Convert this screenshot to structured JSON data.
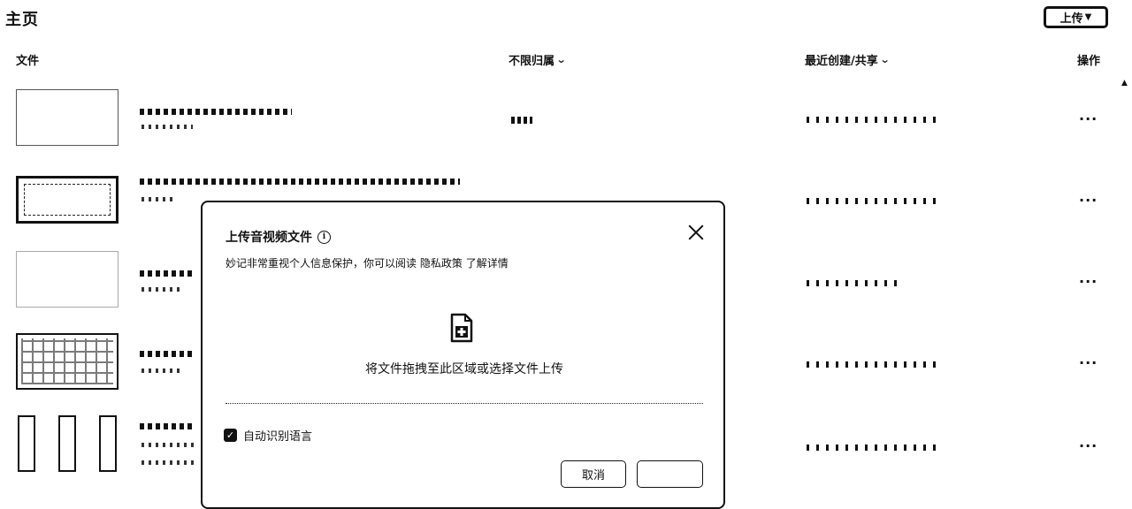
{
  "header": {
    "title": "主页",
    "upload_label": "上传",
    "upload_caret": "▼"
  },
  "columns": {
    "file": "文件",
    "owner": "不限归属",
    "created": "最近创建/共享",
    "ops": "操作",
    "chevron": "⌄"
  },
  "rows": [
    {
      "more": "···"
    },
    {
      "more": "···"
    },
    {
      "more": "···"
    },
    {
      "more": "···"
    },
    {
      "more": "···"
    }
  ],
  "modal": {
    "title": "上传音视频文件",
    "info": "i",
    "privacy_prefix": "妙记非常重视个人信息保护，你可以阅读",
    "privacy_link": "隐私政策",
    "privacy_suffix": "了解详情",
    "drop_text": "将文件拖拽至此区域或选择文件上传",
    "auto_detect_label": "自动识别语言",
    "auto_detect_checked": true,
    "checkmark": "✓",
    "cancel_label": "取消"
  }
}
